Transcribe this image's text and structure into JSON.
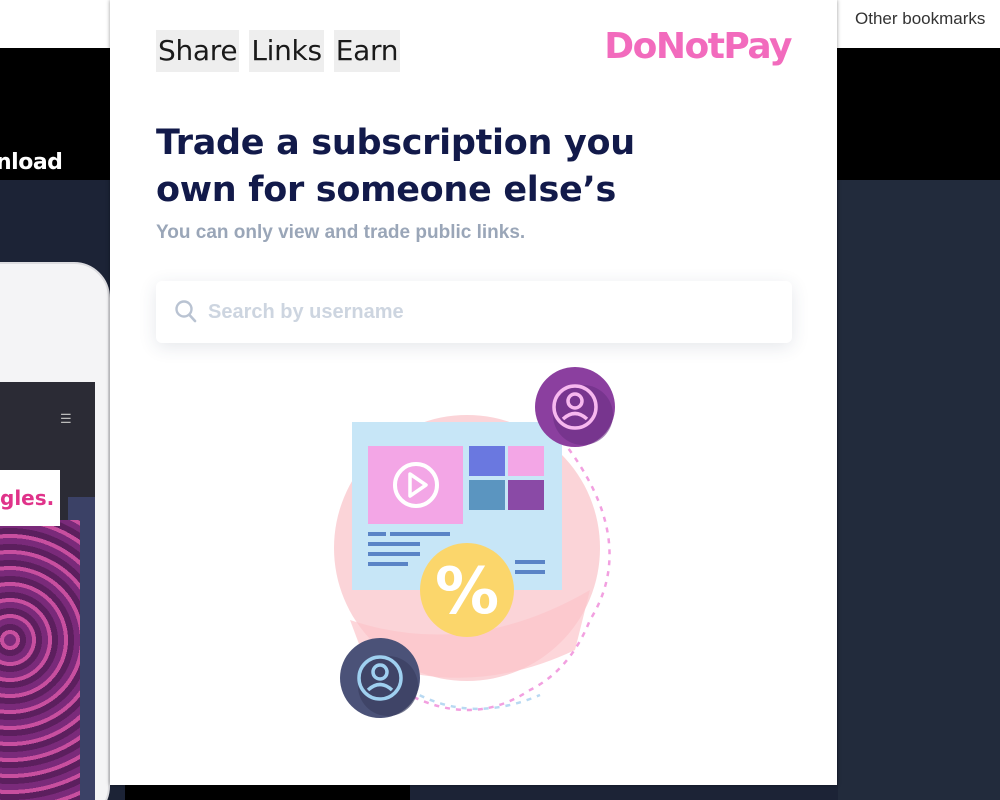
{
  "browser": {
    "bookmarks_label": "Other bookmarks"
  },
  "background_page": {
    "header_link": "nload",
    "phone_banner_text": "gles."
  },
  "popup": {
    "nav": [
      {
        "label": "Share"
      },
      {
        "label": "Links"
      },
      {
        "label": "Earn"
      }
    ],
    "brand": "DoNotPay",
    "headline_line1": "Trade a subscription you",
    "headline_line2": "own for someone else’s",
    "subtitle": "You can only view and trade public links.",
    "search": {
      "placeholder": "Search by username",
      "value": ""
    },
    "illustration": {
      "percent_symbol": "%"
    }
  },
  "colors": {
    "brand_pink": "#f26bbd",
    "headline_navy": "#121a4a",
    "subtitle_gray": "#9aa6b8",
    "placeholder_gray": "#cdd5e0"
  },
  "icons": [
    "search-icon",
    "user-avatar-icon",
    "play-icon",
    "percent-badge-icon",
    "menu-icon"
  ]
}
